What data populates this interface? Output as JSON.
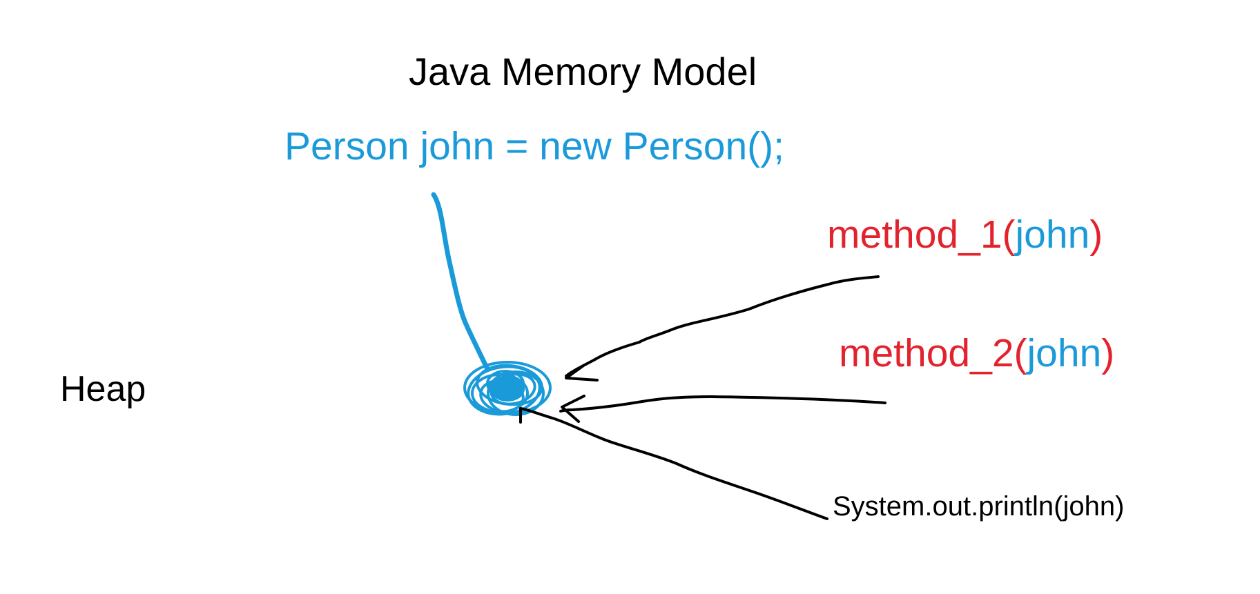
{
  "title": "Java Memory Model",
  "code": {
    "statement": "Person john = new Person();",
    "color": "#1a9ad9"
  },
  "heap_label": "Heap",
  "calls": [
    {
      "name": "method_1",
      "open": "(",
      "arg": "john",
      "close": ")"
    },
    {
      "name": "method_2",
      "open": "(",
      "arg": "john",
      "close": ")"
    },
    {
      "text": "System.out.println(john)"
    }
  ],
  "colors": {
    "method": "#e2232e",
    "argument": "#1a9ad9",
    "reference_line": "#1a9ad9",
    "object": "#1a9ad9",
    "arrows": "#000000",
    "text": "#000000"
  }
}
